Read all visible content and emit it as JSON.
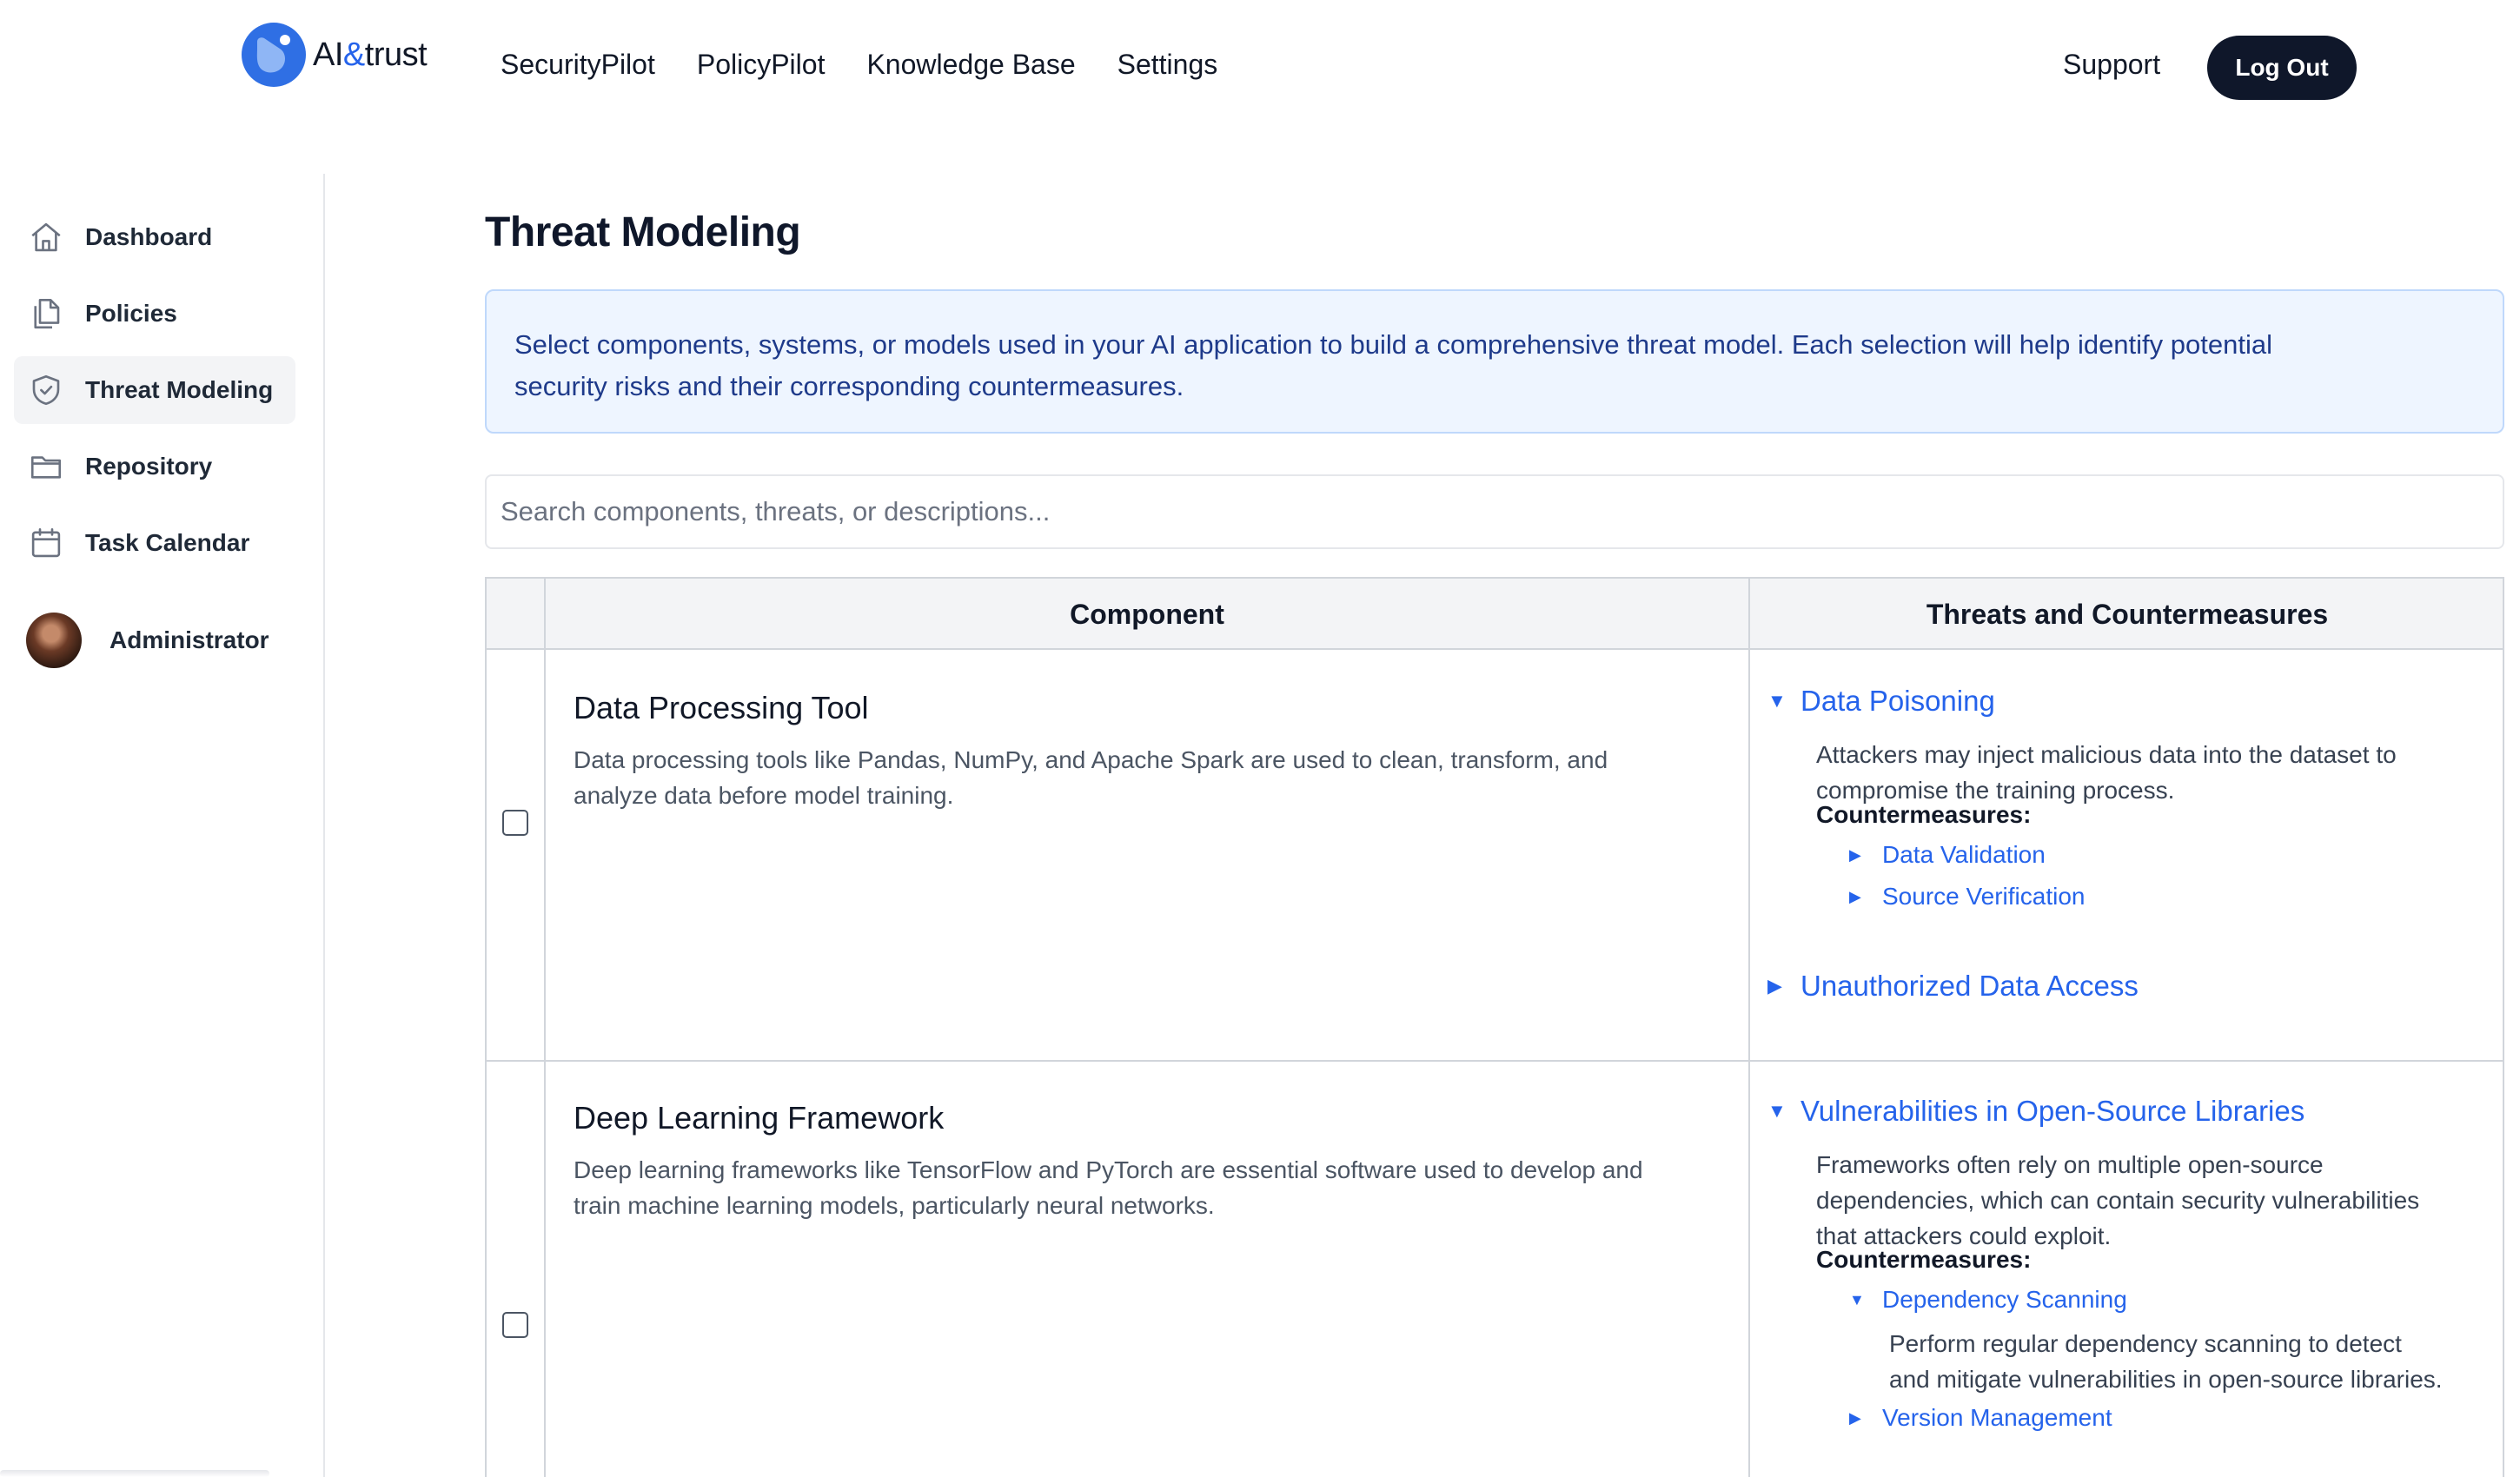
{
  "brand": {
    "name_prefix": "AI",
    "name_amp": "&",
    "name_suffix": "trust",
    "accent": "#2f6fe4"
  },
  "nav": {
    "items": [
      {
        "label": "SecurityPilot"
      },
      {
        "label": "PolicyPilot"
      },
      {
        "label": "Knowledge Base"
      },
      {
        "label": "Settings"
      }
    ],
    "support_label": "Support",
    "logout_label": "Log Out"
  },
  "sidebar": {
    "items": [
      {
        "label": "Dashboard",
        "icon": "home-icon"
      },
      {
        "label": "Policies",
        "icon": "documents-icon"
      },
      {
        "label": "Threat Modeling",
        "icon": "shield-check-icon",
        "active": true
      },
      {
        "label": "Repository",
        "icon": "folder-icon"
      },
      {
        "label": "Task Calendar",
        "icon": "calendar-icon"
      }
    ],
    "user": {
      "name": "Administrator"
    }
  },
  "main": {
    "title": "Threat Modeling",
    "info_line1": "Select components, systems, or models used in your AI application to build a comprehensive threat model. Each selection will help identify potential",
    "info_line2": "security risks and their corresponding countermeasures.",
    "search_placeholder": "Search components, threats, or descriptions...",
    "table": {
      "col_component": "Component",
      "col_threats": "Threats and Countermeasures",
      "rows": [
        {
          "name": "Data Processing Tool",
          "desc_line1": "Data processing tools like Pandas, NumPy, and Apache Spark are used to clean, transform, and",
          "desc_line2": "analyze data before model training.",
          "checked": false,
          "threats": [
            {
              "label": "Data Poisoning",
              "expanded": true,
              "desc_line1": "Attackers may inject malicious data into the dataset to",
              "desc_line2": "compromise the training process.",
              "countermeasures_label": "Countermeasures:",
              "countermeasures": [
                {
                  "label": "Data Validation"
                },
                {
                  "label": "Source Verification"
                }
              ]
            },
            {
              "label": "Unauthorized Data Access",
              "expanded": false
            }
          ]
        },
        {
          "name": "Deep Learning Framework",
          "desc_line1": "Deep learning frameworks like TensorFlow and PyTorch are essential software used to develop and",
          "desc_line2": "train machine learning models, particularly neural networks.",
          "checked": false,
          "threats": [
            {
              "label": "Vulnerabilities in Open-Source Libraries",
              "expanded": true,
              "desc_line1": "Frameworks often rely on multiple open-source",
              "desc_line2": "dependencies, which can contain security vulnerabilities",
              "desc_line3": "that attackers could exploit.",
              "countermeasures_label": "Countermeasures:",
              "countermeasures": [
                {
                  "label": "Dependency Scanning",
                  "expanded": true,
                  "desc_line1": "Perform regular dependency scanning to detect",
                  "desc_line2": "and mitigate vulnerabilities in open-source libraries."
                },
                {
                  "label": "Version Management",
                  "expanded": false
                }
              ]
            }
          ]
        }
      ]
    }
  }
}
